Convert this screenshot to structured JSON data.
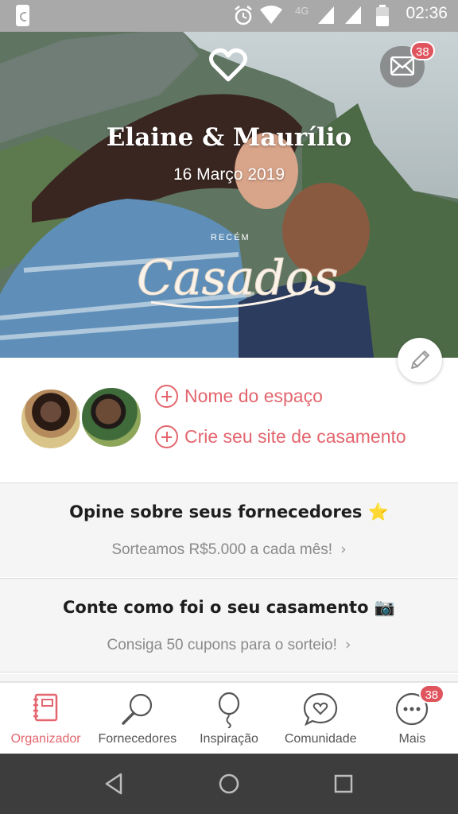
{
  "status_bar": {
    "time": "02:36",
    "network": "4G",
    "icons": [
      "notification-icon",
      "alarm-icon",
      "wifi-icon",
      "signal-icon",
      "signal-icon",
      "battery-icon"
    ]
  },
  "cover": {
    "couple_names": "Elaine & Maurílio",
    "date": "16 Março 2019",
    "mail_badge": "38",
    "overlay_text": "Casados",
    "overlay_small": "RECÉM"
  },
  "profile": {
    "links": [
      {
        "label": "Nome do espaço"
      },
      {
        "label": "Crie seu site de casamento"
      }
    ]
  },
  "cards": [
    {
      "title": "Opine sobre seus fornecedores ⭐",
      "subtitle": "Sorteamos R$5.000 a cada mês!"
    },
    {
      "title": "Conte como foi o seu casamento 📷",
      "subtitle": "Consiga 50 cupons para o sorteio!"
    }
  ],
  "bottom_nav": {
    "items": [
      {
        "label": "Organizador",
        "icon": "notebook-icon",
        "active": true
      },
      {
        "label": "Fornecedores",
        "icon": "magnifier-icon",
        "active": false
      },
      {
        "label": "Inspiração",
        "icon": "balloon-icon",
        "active": false
      },
      {
        "label": "Comunidade",
        "icon": "chat-heart-icon",
        "active": false
      },
      {
        "label": "Mais",
        "icon": "more-icon",
        "active": false,
        "badge": "38"
      }
    ]
  },
  "colors": {
    "accent": "#e3666e",
    "badge": "#e0545e",
    "status_bar": "#a9a9a9",
    "android_nav": "#3d3d3d"
  }
}
